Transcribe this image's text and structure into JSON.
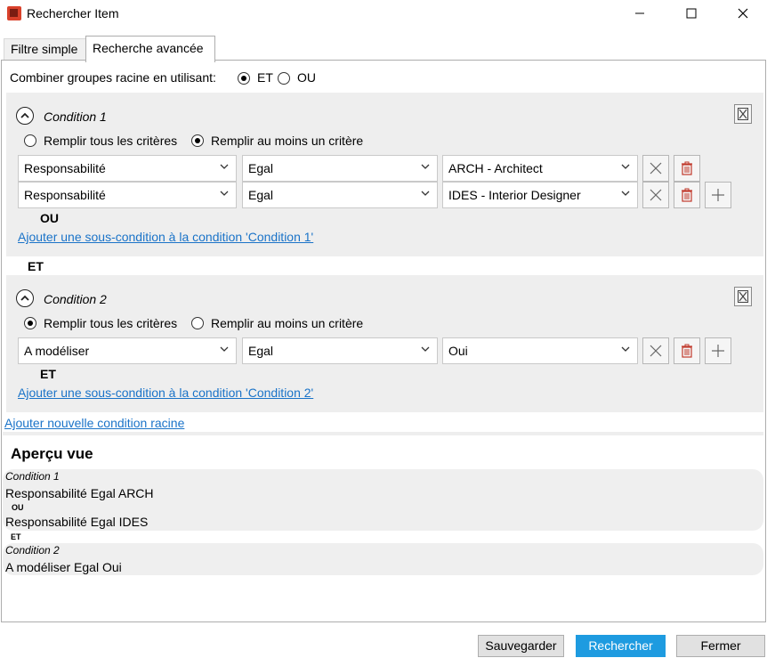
{
  "window": {
    "title": "Rechercher Item"
  },
  "tabs": [
    {
      "label": "Filtre simple"
    },
    {
      "label": "Recherche avancée"
    }
  ],
  "combine": {
    "label": "Combiner groupes racine en utilisant:",
    "options": [
      "ET",
      "OU"
    ],
    "selected": "ET"
  },
  "conditions": [
    {
      "title": "Condition 1",
      "match_options": [
        "Remplir tous les critères",
        "Remplir au moins un critère"
      ],
      "match_selected": "Remplir au moins un critère",
      "rows": [
        {
          "field": "Responsabilité",
          "operator": "Egal",
          "value": "ARCH - Architect"
        },
        {
          "field": "Responsabilité",
          "operator": "Egal",
          "value": "IDES - Interior Designer"
        }
      ],
      "joiner": "OU",
      "add_sub_link": "Ajouter une sous-condition à la condition 'Condition 1'"
    },
    {
      "title": "Condition 2",
      "match_options": [
        "Remplir tous les critères",
        "Remplir au moins un critère"
      ],
      "match_selected": "Remplir tous les critères",
      "rows": [
        {
          "field": "A modéliser",
          "operator": "Egal",
          "value": "Oui"
        }
      ],
      "joiner": "ET",
      "add_sub_link": "Ajouter une sous-condition à la condition 'Condition 2'"
    }
  ],
  "root_joiner": "ET",
  "add_root_link": "Ajouter nouvelle condition racine",
  "preview": {
    "title": "Aperçu vue",
    "groups": [
      {
        "condition": "Condition 1",
        "lines": [
          "Responsabilité Egal ARCH",
          "Responsabilité Egal IDES"
        ],
        "op": "OU"
      },
      {
        "condition": "Condition 2",
        "lines": [
          "A modéliser Egal Oui"
        ]
      }
    ],
    "between": "ET"
  },
  "buttons": {
    "save": "Sauvegarder",
    "search": "Rechercher",
    "close": "Fermer"
  },
  "colors": {
    "accent": "#1e9be0",
    "link": "#1a73c8",
    "app_icon": "#d9412b"
  },
  "icons": [
    "app-icon",
    "minimize-icon",
    "maximize-icon",
    "close-icon",
    "collapse-up-icon",
    "remove-condition-icon",
    "clear-icon",
    "trash-icon",
    "plus-icon",
    "chevron-down-icon"
  ]
}
